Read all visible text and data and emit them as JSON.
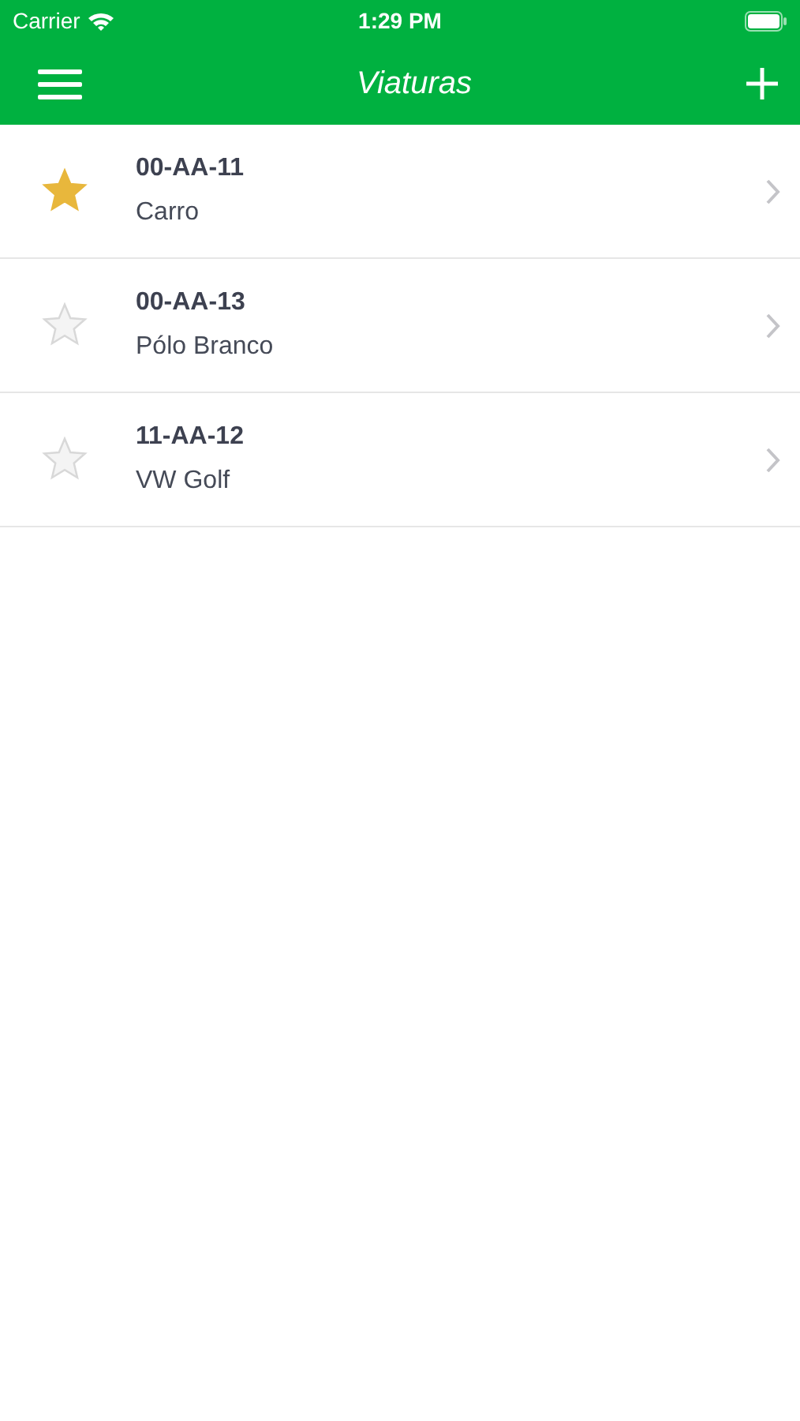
{
  "status_bar": {
    "carrier": "Carrier",
    "time": "1:29 PM"
  },
  "nav_bar": {
    "title": "Viaturas"
  },
  "vehicles": [
    {
      "plate": "00-AA-11",
      "name": "Carro",
      "favorite": true
    },
    {
      "plate": "00-AA-13",
      "name": "Pólo Branco",
      "favorite": false
    },
    {
      "plate": "11-AA-12",
      "name": "VW Golf",
      "favorite": false
    }
  ]
}
